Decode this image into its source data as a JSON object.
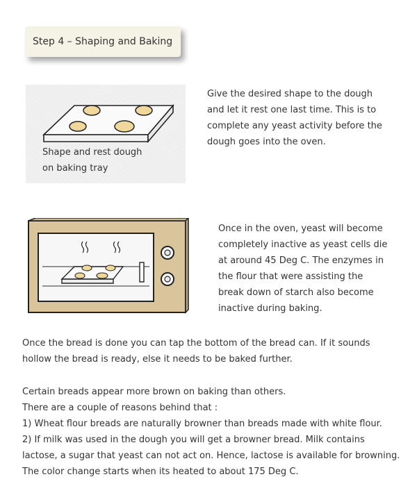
{
  "header": {
    "title": "Step 4 – Shaping and Baking"
  },
  "tray_figure": {
    "caption_lines": [
      "Shape and rest dough",
      "on baking tray"
    ]
  },
  "intro_paragraph": {
    "lines": [
      "Give the desired shape to the dough",
      "and let it rest one last time. This is to",
      "complete any yeast activity before the",
      "dough goes into the oven."
    ]
  },
  "oven_paragraph": {
    "lines": [
      "Once in the oven, yeast will become",
      "completely inactive as yeast cells die",
      "at around 45 Deg C. The enzymes in",
      "the flour that were assisting the",
      "break down of starch also become",
      "inactive during baking."
    ]
  },
  "done_paragraph": {
    "lines": [
      "Once the bread is done you can tap the bottom of the bread can. If it sounds",
      "hollow the bread is ready, else it needs to be baked further."
    ]
  },
  "browning_paragraph": {
    "lines": [
      "Certain breads appear more brown on baking than others.",
      "There are a couple of reasons behind that :",
      "1) Wheat flour breads are naturally browner than breads made with white flour.",
      "2) If milk was used in the dough you will get a browner bread. Milk contains",
      "lactose, a sugar that yeast can not act on. Hence, lactose is available for browning.",
      "The color change starts when its heated to about 175 Deg C."
    ]
  },
  "colors": {
    "header_background": "#f5f2e6",
    "dough": "#f0d79b",
    "oven_body": "#d9c49c",
    "oven_window": "#f7f7f7"
  }
}
